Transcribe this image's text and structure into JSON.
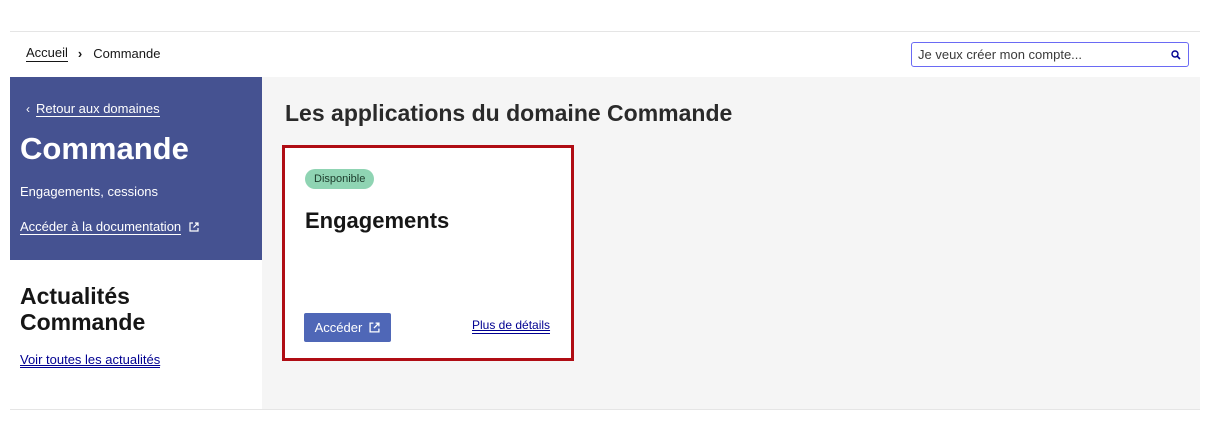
{
  "breadcrumb": {
    "home": "Accueil",
    "separator": "›",
    "current": "Commande"
  },
  "search": {
    "placeholder": "Je veux créer mon compte..."
  },
  "sidebar": {
    "back_link": "Retour aux domaines",
    "back_chevron": "‹",
    "domain_title": "Commande",
    "domain_subtitle": "Engagements, cessions",
    "doc_link": "Accéder à la documentation"
  },
  "news": {
    "title": "Actualités Commande",
    "see_all": "Voir toutes les actualités"
  },
  "main": {
    "title": "Les applications du domaine Commande",
    "cards": [
      {
        "badge": "Disponible",
        "title": "Engagements",
        "access_button": "Accéder",
        "details_link": "Plus de détails"
      }
    ]
  },
  "colors": {
    "sidebar_bg": "#455291",
    "badge_bg": "#8fd4b3",
    "button_bg": "#4f67b7",
    "highlight_border": "#b00d14",
    "link": "#000091"
  },
  "icons": {
    "search": "search-icon",
    "external": "external-link-icon"
  }
}
